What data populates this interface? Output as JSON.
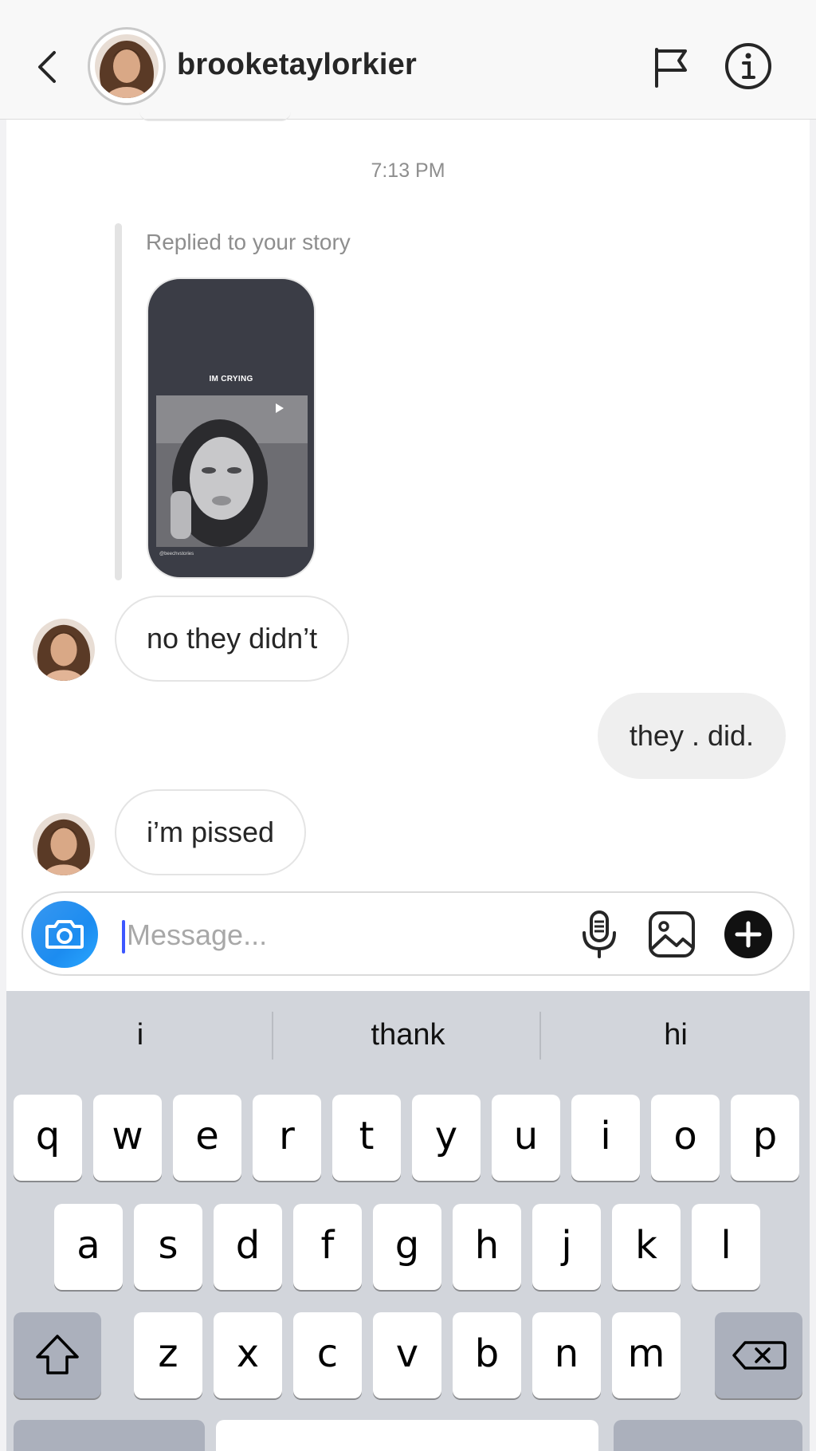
{
  "header": {
    "username": "brooketaylorkier"
  },
  "thread": {
    "timestamp": "7:13 PM",
    "reply_label": "Replied to your story",
    "story": {
      "caption": "IM CRYING",
      "credit": "@beechvstories"
    },
    "messages": [
      {
        "from": "them",
        "text": "no they didn’t"
      },
      {
        "from": "me",
        "text": "they . did."
      },
      {
        "from": "them",
        "text": "i’m pissed"
      }
    ]
  },
  "composer": {
    "placeholder": "Message...",
    "value": ""
  },
  "keyboard": {
    "suggestions": [
      "i",
      "thank",
      "hi"
    ],
    "row1": [
      "q",
      "w",
      "e",
      "r",
      "t",
      "y",
      "u",
      "i",
      "o",
      "p"
    ],
    "row2": [
      "a",
      "s",
      "d",
      "f",
      "g",
      "h",
      "j",
      "k",
      "l"
    ],
    "row3": [
      "z",
      "x",
      "c",
      "v",
      "b",
      "n",
      "m"
    ]
  },
  "colors": {
    "camera_button": "#3897f0",
    "cursor": "#3d57ff",
    "outgoing_bubble": "#efefef",
    "keyboard_bg": "#d2d5db"
  },
  "icons": [
    "chevron-left-icon",
    "flag-icon",
    "info-icon",
    "camera-icon",
    "microphone-icon",
    "gallery-icon",
    "plus-circle-icon",
    "shift-icon",
    "backspace-icon"
  ]
}
